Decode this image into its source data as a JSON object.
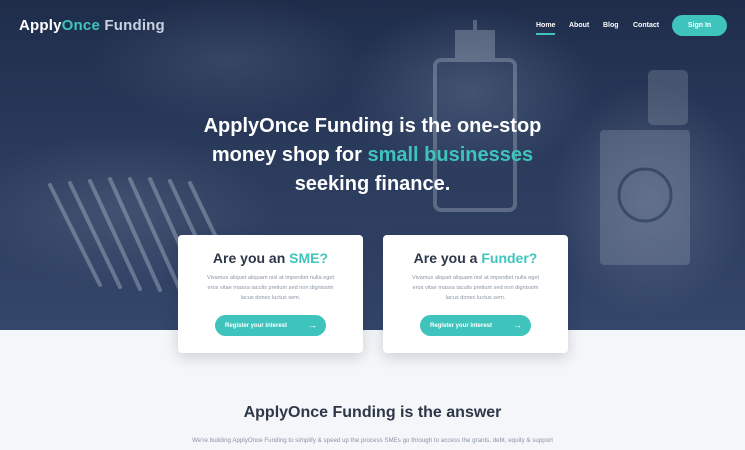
{
  "brand": {
    "part1": "Apply",
    "part2": "Once",
    "part3": " Funding"
  },
  "nav": {
    "items": [
      "Home",
      "About",
      "Blog",
      "Contact"
    ],
    "active": "Home",
    "signin_label": "Sign In"
  },
  "hero": {
    "line1": "ApplyOnce Funding is the one-stop",
    "line2_pre": "money shop for ",
    "line2_highlight": "small businesses",
    "line3": "seeking finance."
  },
  "cards": {
    "sme": {
      "title_pre": "Are you an ",
      "title_highlight": "SME?",
      "body": "Vivamus aliquet aliquam nisl at imperdiet nulla eget eros vitae massa iaculis pretium sed non dignissim lacus donec luctus sem.",
      "button_label": "Register your interest",
      "button_icon": "arrow-right-icon"
    },
    "funder": {
      "title_pre": "Are you a ",
      "title_highlight": "Funder?",
      "body": "Vivamus aliquet aliquam nisl at imperdiet nulla eget eros vitae massa iaculis pretium sed non dignissim lacus donec luctus sem.",
      "button_label": "Register your interest",
      "button_icon": "arrow-right-icon"
    }
  },
  "section": {
    "title": "ApplyOnce Funding is the answer",
    "subtitle": "We're building ApplyOnce Funding to simplify & speed up the process SMEs go through to access the grants, debt, equity & support"
  },
  "colors": {
    "accent": "#3fc4bd",
    "hero_bg": "#2a3a5b",
    "heading": "#2d3748",
    "body_text": "#8a94a6"
  }
}
